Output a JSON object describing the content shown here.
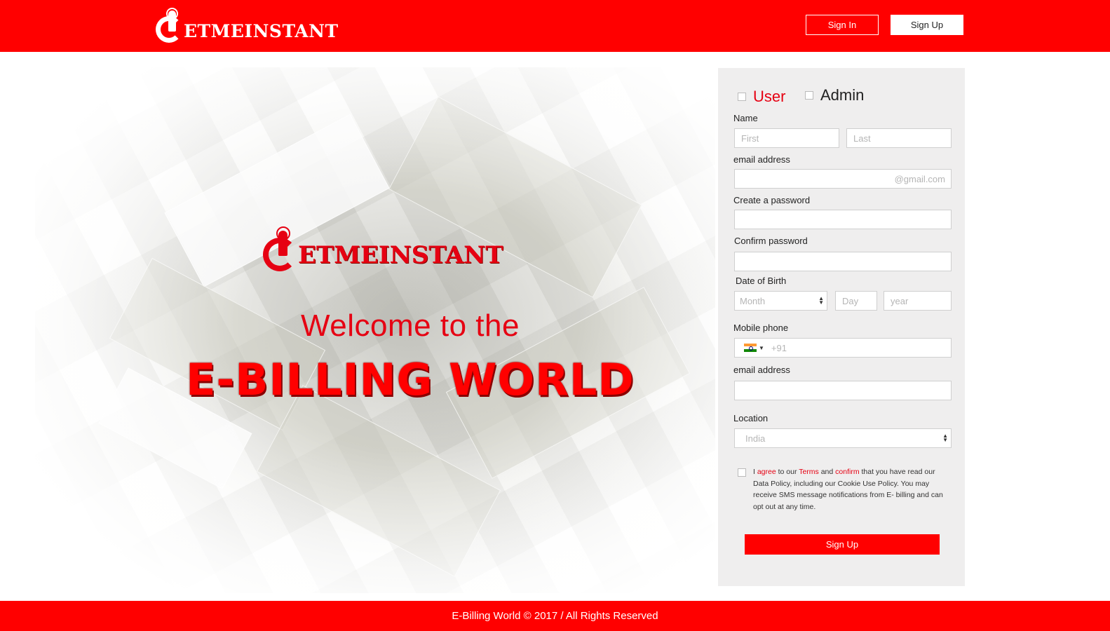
{
  "header": {
    "logo_text": "ETMEINSTANT",
    "signin_label": "Sign In",
    "signup_label": "Sign Up"
  },
  "hero": {
    "logo_text": "ETMEINSTANT",
    "welcome": "Welcome to the",
    "headline": "E-BILLING WORLD"
  },
  "form": {
    "roles": {
      "user": "User",
      "admin": "Admin"
    },
    "name_label": "Name",
    "first_placeholder": "First",
    "last_placeholder": "Last",
    "email_label": "email address",
    "email_suffix": "@gmail.com",
    "password_label": "Create a password",
    "confirm_label": "Confirm password",
    "dob_label": "Date of Birth",
    "month_placeholder": "Month",
    "day_placeholder": "Day",
    "year_placeholder": "year",
    "mobile_label": "Mobile phone",
    "mobile_prefix": "+91",
    "email2_label": "email address",
    "location_label": "Location",
    "location_value": "India",
    "terms": {
      "t1": "I ",
      "agree": "agree",
      "t2": " to our ",
      "terms_link": "Terms",
      "t3": " and ",
      "confirm": "confirm",
      "t4": " that you have read our Data Policy, including our Cookie Use Policy. You may receive SMS message notifications from E- billing and can opt out at any time."
    },
    "submit_label": "Sign Up"
  },
  "footer": {
    "text": "E-Billing World © 2017 / All Rights Reserved"
  },
  "colors": {
    "brand_red": "#ff0000",
    "panel_bg": "#efeeee"
  }
}
